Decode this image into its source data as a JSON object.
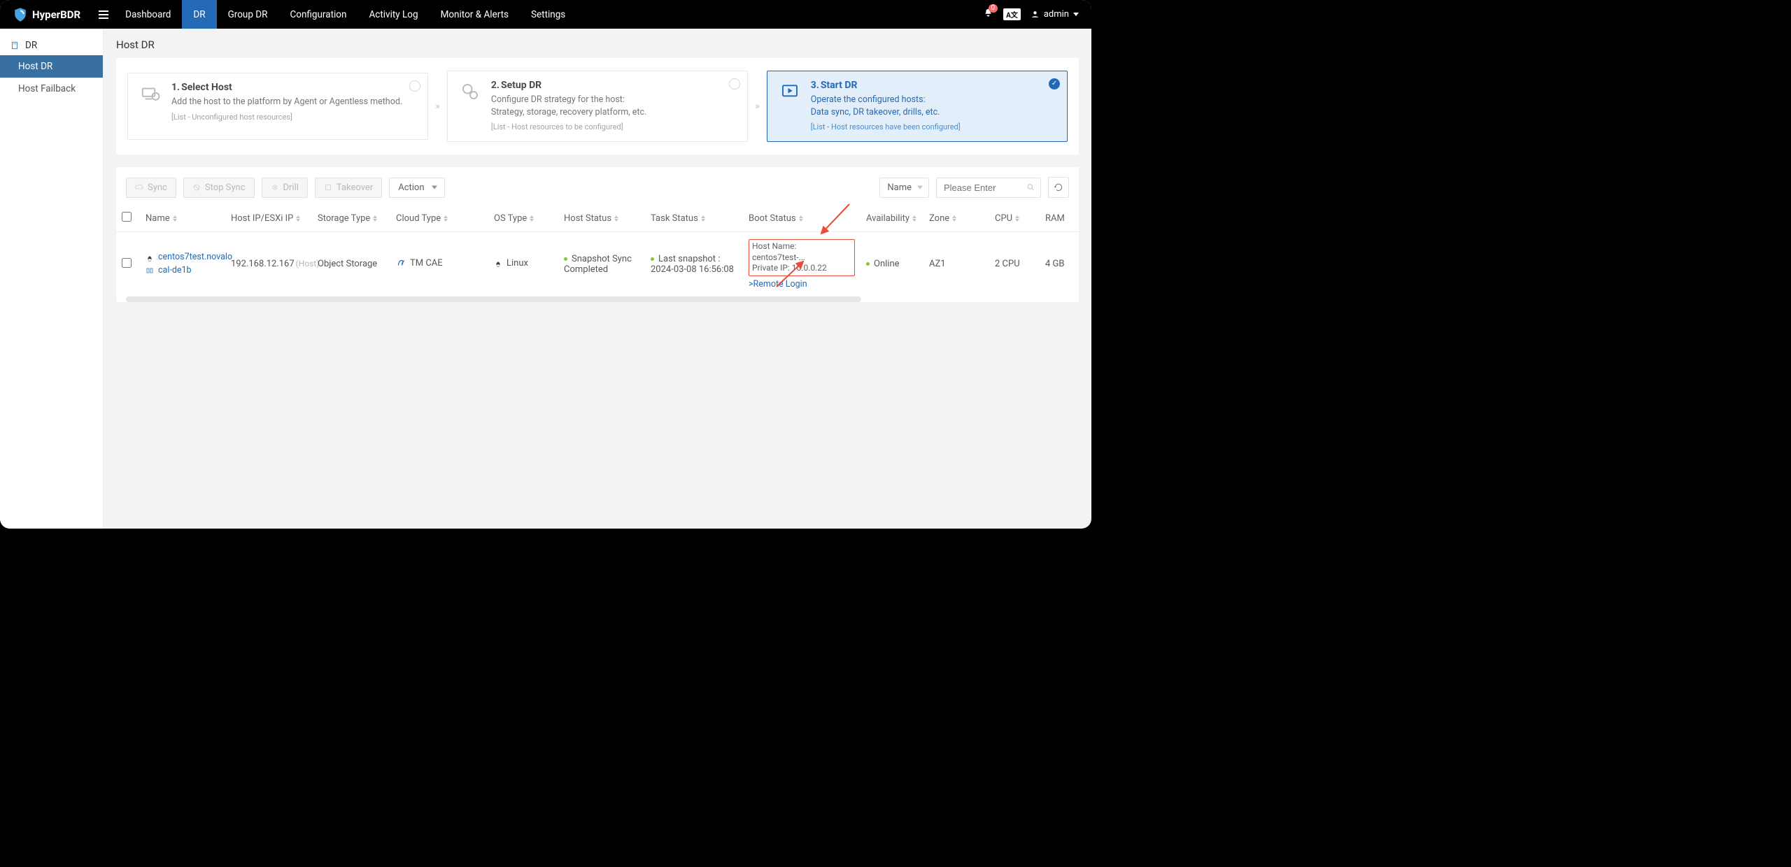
{
  "brand": "HyperBDR",
  "nav": [
    "Dashboard",
    "DR",
    "Group DR",
    "Configuration",
    "Activity Log",
    "Monitor & Alerts",
    "Settings"
  ],
  "nav_active_index": 1,
  "alerts_count": "0",
  "lang_badge": "A文",
  "user": "admin",
  "sidebar": {
    "heading": "DR",
    "items": [
      "Host DR",
      "Host Failback"
    ],
    "active_index": 0
  },
  "page_title": "Host DR",
  "steps": [
    {
      "num": "1.",
      "title": "Select Host",
      "desc": "Add the host to the platform by Agent or Agentless method.",
      "meta": "[List - Unconfigured host resources]"
    },
    {
      "num": "2.",
      "title": "Setup DR",
      "desc": "Configure DR strategy for the host:\nStrategy, storage, recovery platform, etc.",
      "meta": "[List - Host resources to be configured]"
    },
    {
      "num": "3.",
      "title": "Start DR",
      "desc": "Operate the configured hosts:\nData sync, DR takeover, drills, etc.",
      "meta": "[List - Host resources have been configured]"
    }
  ],
  "toolbar": {
    "sync": "Sync",
    "stop_sync": "Stop Sync",
    "drill": "Drill",
    "takeover": "Takeover",
    "action": "Action",
    "filter_field": "Name",
    "search_placeholder": "Please Enter"
  },
  "columns": [
    "",
    "Name",
    "Host IP/ESXi IP",
    "Storage Type",
    "Cloud Type",
    "OS Type",
    "Host Status",
    "Task Status",
    "Boot Status",
    "Availability",
    "Zone",
    "CPU",
    "RAM"
  ],
  "row": {
    "name_line1": "centos7test.novalo",
    "name_line2": "cal-de1b",
    "host_ip": "192.168.12.167",
    "host_ip_tag": "(Host)",
    "storage_type": "Object Storage",
    "cloud_type": "TM CAE",
    "os_type": "Linux",
    "host_status": "Snapshot Sync Completed",
    "task_status": "Last snapshot : 2024-03-08 16:56:08",
    "boot_line1": "Host Name: centos7test-...",
    "boot_line2": "Private IP: 10.0.0.22",
    "remote_login": ">Remote Login",
    "availability": "Online",
    "zone": "AZ1",
    "cpu": "2 CPU",
    "ram": "4 GB"
  }
}
